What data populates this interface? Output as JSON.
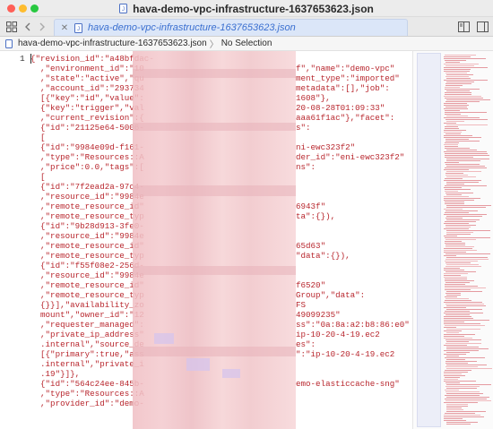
{
  "window": {
    "title": "hava-demo-vpc-infrastructure-1637653623.json"
  },
  "tab": {
    "label": "hava-demo-vpc-infrastructure-1637653623.json",
    "close": "✕"
  },
  "breadcrumb": {
    "file": "hava-demo-vpc-infrastructure-1637653623.json",
    "separator": "〉",
    "selection": "No Selection"
  },
  "editor": {
    "line_number": "1",
    "colors": {
      "string": "#b8262d",
      "background": "#ffffff",
      "redaction": "#f0c4c8"
    },
    "lines": [
      {
        "left": "{\"revision_id\":\"a48bfdac-",
        "right": ""
      },
      {
        "left": "  ,\"environment_id\":\"10",
        "right": "f\",\"name\":\"demo-vpc\""
      },
      {
        "left": "  ,\"state\":\"active\",\"qu",
        "right": "ment_type\":\"imported\""
      },
      {
        "left": "  ,\"account_id\":\"293734",
        "right": "metadata\":[],\"job\":"
      },
      {
        "left": "  [{\"key\":\"id\",\"value\":",
        "right": "1608\"},"
      },
      {
        "left": "  {\"key\":\"trigger\",\"val",
        "right": "20-08-28T01:09:33\""
      },
      {
        "left": "  ,\"current_revision\":{",
        "right": "aaa61f1ac\"},\"facet\":"
      },
      {
        "left": "  {\"id\":\"21125e64-5006-",
        "right": "s\":"
      },
      {
        "left": "  [",
        "right": ""
      },
      {
        "left": "  {\"id\":\"9984e09d-f161-",
        "right": "ni-ewc323f2\""
      },
      {
        "left": "  ,\"type\":\"Resources::A",
        "right": "der_id\":\"eni-ewc323f2\""
      },
      {
        "left": "  ,\"price\":0.0,\"tags\":[",
        "right": "ns\":"
      },
      {
        "left": "  [",
        "right": ""
      },
      {
        "left": "  {\"id\":\"7f2ead2a-97c4-",
        "right": ""
      },
      {
        "left": "  ,\"resource_id\":\"9984e",
        "right": ""
      },
      {
        "left": "  ,\"remote_resource_id\"",
        "right": "6943f\""
      },
      {
        "left": "  ,\"remote_resource_typ",
        "right": "ta\":{}),"
      },
      {
        "left": "  {\"id\":\"9b28d913-3fe0-",
        "right": ""
      },
      {
        "left": "  ,\"resource_id\":\"9984e",
        "right": ""
      },
      {
        "left": "  ,\"remote_resource_id\"",
        "right": "65d63\""
      },
      {
        "left": "  ,\"remote_resource_typ",
        "right": "\"data\":{}),"
      },
      {
        "left": "  {\"id\":\"f55f08e2-256d-",
        "right": ""
      },
      {
        "left": "  ,\"resource_id\":\"9984e",
        "right": ""
      },
      {
        "left": "  ,\"remote_resource_id\"",
        "right": "f6520\""
      },
      {
        "left": "  ,\"remote_resource_typ",
        "right": "Group\",\"data\":"
      },
      {
        "left": "  {}}],\"availability_zo",
        "right": "FS"
      },
      {
        "left": "  mount\",\"owner_id\":\"12",
        "right": "49099235\""
      },
      {
        "left": "  ,\"requester_managed\":",
        "right": "ss\":\"0a:8a:a2:b8:86:e0\""
      },
      {
        "left": "  ,\"private_ip_address\"",
        "right": "ip-10-20-4-19.ec2"
      },
      {
        "left": "  .internal\",\"source_de",
        "right": "es\":"
      },
      {
        "left": "  [{\"primary\":true,\"ass",
        "right": "\":\"ip-10-20-4-19.ec2"
      },
      {
        "left": "  .internal\",\"private_i",
        "right": ""
      },
      {
        "left": "  .19\"}]},",
        "right": ""
      },
      {
        "left": "  {\"id\":\"564c24ee-845b-",
        "right": "emo-elasticcache-sng\""
      },
      {
        "left": "  ,\"type\":\"Resources::A",
        "right": ""
      },
      {
        "left": "  ,\"provider_id\":\"demo-",
        "right": ""
      }
    ]
  },
  "icons": {
    "doc": "document-icon",
    "grid": "grid-icon",
    "back": "chevron-left-icon",
    "forward": "chevron-right-icon",
    "split": "split-editor-icon",
    "panel": "inspector-panel-icon"
  }
}
